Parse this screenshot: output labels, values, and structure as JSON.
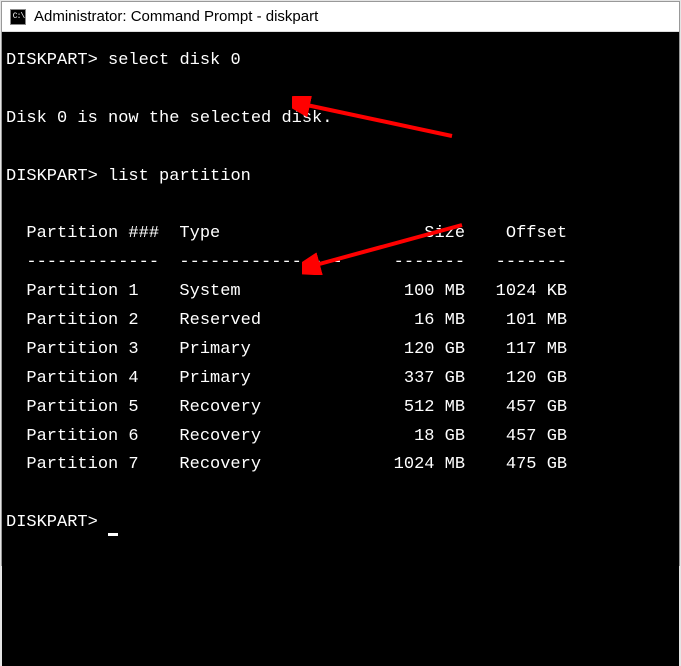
{
  "titlebar": {
    "title": "Administrator: Command Prompt - diskpart",
    "icon_glyph": "C:\\"
  },
  "prompt": "DISKPART>",
  "lines": {
    "cmd1": "select disk 0",
    "response1": "Disk 0 is now the selected disk.",
    "cmd2": "list partition"
  },
  "table": {
    "headers": {
      "col1": "Partition ###",
      "col2": "Type",
      "col3": "Size",
      "col4": "Offset"
    },
    "separators": {
      "col1": "-------------",
      "col2": "----------------",
      "col3": "-------",
      "col4": "-------"
    },
    "rows": [
      {
        "name": "Partition 1",
        "type": "System",
        "size": "100 MB",
        "offset": "1024 KB"
      },
      {
        "name": "Partition 2",
        "type": "Reserved",
        "size": "16 MB",
        "offset": "101 MB"
      },
      {
        "name": "Partition 3",
        "type": "Primary",
        "size": "120 GB",
        "offset": "117 MB"
      },
      {
        "name": "Partition 4",
        "type": "Primary",
        "size": "337 GB",
        "offset": "120 GB"
      },
      {
        "name": "Partition 5",
        "type": "Recovery",
        "size": "512 MB",
        "offset": "457 GB"
      },
      {
        "name": "Partition 6",
        "type": "Recovery",
        "size": "18 GB",
        "offset": "457 GB"
      },
      {
        "name": "Partition 7",
        "type": "Recovery",
        "size": "1024 MB",
        "offset": "475 GB"
      }
    ]
  },
  "annotations": {
    "arrow1_color": "#ff0000",
    "arrow2_color": "#ff0000"
  }
}
